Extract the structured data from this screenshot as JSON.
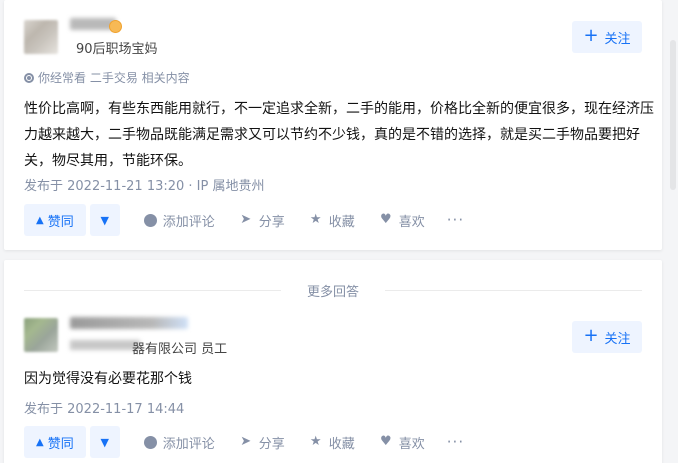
{
  "answer1": {
    "author_subtitle": "90后职场宝妈",
    "follow_label": "关注",
    "meta_tags": "你经常看 二手交易 相关内容",
    "content": "性价比高啊，有些东西能用就行，不一定追求全新，二手的能用，价格比全新的便宜很多，现在经济压力越来越大，二手物品既能满足需求又可以节约不少钱，真的是不错的选择，就是买二手物品要把好关，物尽其用，节能环保。",
    "time": "发布于 2022-11-21 13:20 · IP 属地贵州"
  },
  "answer2": {
    "author_subtitle": "器有限公司 员工",
    "follow_label": "关注",
    "content": "因为觉得没有必要花那个钱",
    "time": "发布于 2022-11-17 14:44"
  },
  "actions": {
    "upvote": "赞同",
    "comment": "添加评论",
    "share": "分享",
    "favorite": "收藏",
    "like": "喜欢",
    "more": "···"
  },
  "divider_label": "更多回答",
  "colors": {
    "accent": "#1772f6",
    "accent_bg": "#eef4ff",
    "muted": "#8590a6"
  }
}
